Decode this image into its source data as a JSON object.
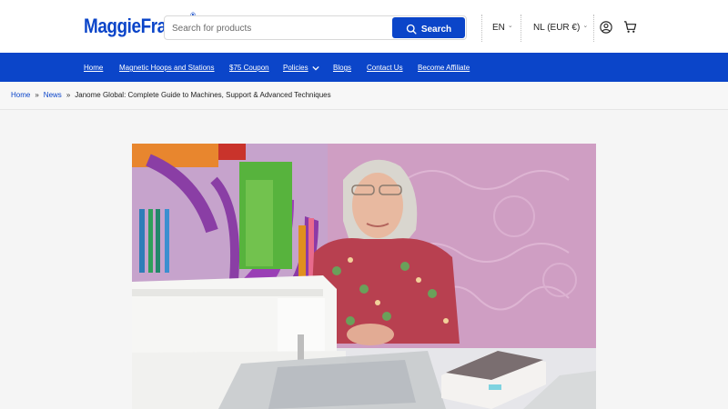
{
  "brand": {
    "name": "MaggieFrame",
    "reg": "®"
  },
  "search": {
    "placeholder": "Search for products",
    "button_label": "Search"
  },
  "locale": {
    "language": "EN",
    "currency": "NL (EUR €)"
  },
  "nav": {
    "items": [
      {
        "label": "Home"
      },
      {
        "label": "Magnetic Hoops and Stations"
      },
      {
        "label": "$75 Coupon"
      },
      {
        "label": "Policies"
      },
      {
        "label": "Blogs"
      },
      {
        "label": "Contact Us"
      },
      {
        "label": "Become Affiliate"
      }
    ]
  },
  "breadcrumb": {
    "items": [
      "Home",
      "News",
      "Janome Global: Complete Guide to Machines, Support & Advanced Techniques"
    ],
    "separator": "»"
  },
  "icons": [
    "search-icon",
    "user-icon",
    "cart-icon",
    "chevron-down-icon"
  ],
  "colors": {
    "brand_blue": "#0b45c9",
    "background": "#f5f5f5"
  }
}
